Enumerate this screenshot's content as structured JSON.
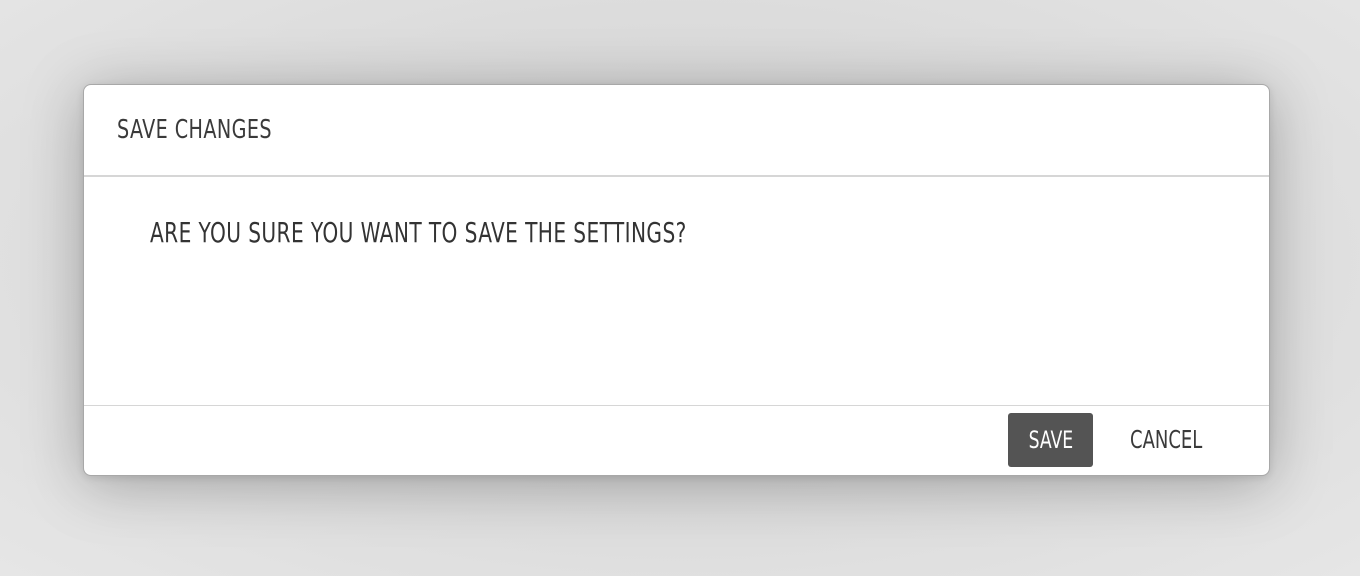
{
  "dialog": {
    "title": "SAVE CHANGES",
    "message": "ARE YOU SURE YOU WANT TO SAVE THE SETTINGS?",
    "save_label": "SAVE",
    "cancel_label": "CANCEL"
  },
  "colors": {
    "backdrop": "#dcdcdc",
    "dialog_background": "#ffffff",
    "primary_button": "#545454",
    "text": "#3a3a3a"
  }
}
